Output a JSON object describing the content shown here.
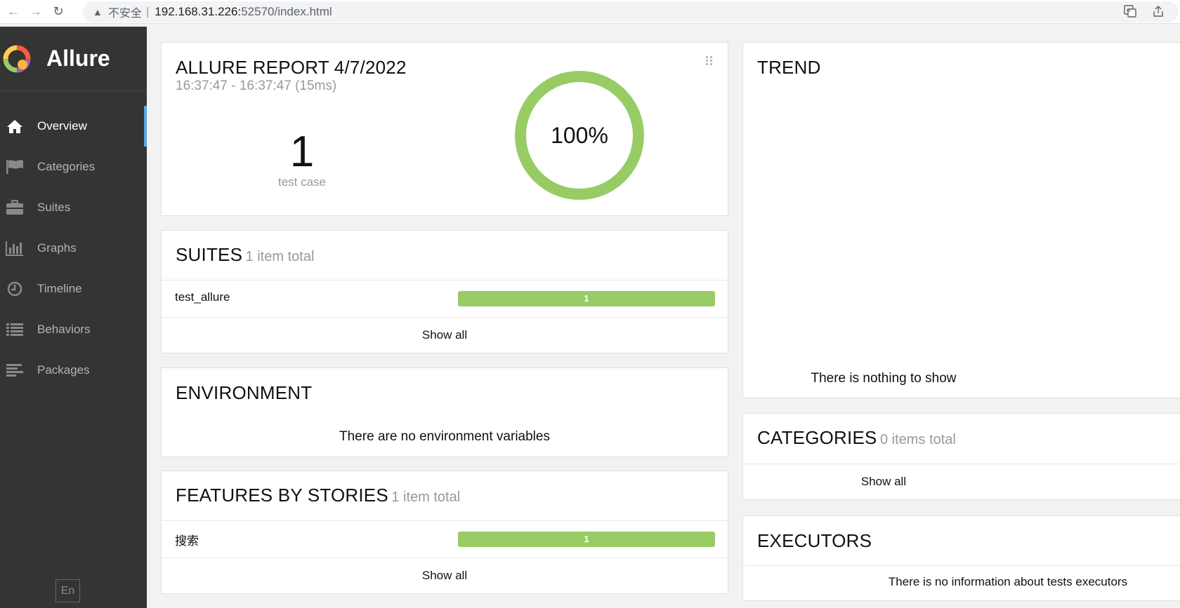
{
  "browser": {
    "back_icon": "←",
    "forward_icon": "→",
    "reload_icon": "↻",
    "security_warning": "不安全",
    "url_host": "192.168.31.226:",
    "url_rest": "52570/index.html"
  },
  "sidebar": {
    "brand": "Allure",
    "items": [
      {
        "label": "Overview",
        "icon": "home-icon",
        "active": true
      },
      {
        "label": "Categories",
        "icon": "flag-icon"
      },
      {
        "label": "Suites",
        "icon": "briefcase-icon"
      },
      {
        "label": "Graphs",
        "icon": "bar-chart-icon"
      },
      {
        "label": "Timeline",
        "icon": "clock-icon"
      },
      {
        "label": "Behaviors",
        "icon": "list-icon"
      },
      {
        "label": "Packages",
        "icon": "align-left-icon"
      }
    ],
    "language": "En"
  },
  "summary": {
    "title": "ALLURE REPORT 4/7/2022",
    "time_range": "16:37:47 - 16:37:47 (15ms)",
    "test_count": "1",
    "test_count_label": "test case",
    "percent": "100%",
    "pass_fraction": 1.0
  },
  "suites": {
    "title": "SUITES",
    "subtitle": "1 item total",
    "rows": [
      {
        "name": "test_allure",
        "count": "1"
      }
    ],
    "show_all": "Show all"
  },
  "environment": {
    "title": "ENVIRONMENT",
    "message": "There are no environment variables"
  },
  "features": {
    "title": "FEATURES BY STORIES",
    "subtitle": "1 item total",
    "rows": [
      {
        "name": "搜索",
        "count": "1"
      }
    ],
    "show_all": "Show all"
  },
  "trend": {
    "title": "TREND",
    "message": "There is nothing to show"
  },
  "categories": {
    "title": "CATEGORIES",
    "subtitle": "0 items total",
    "show_all": "Show all"
  },
  "executors": {
    "title": "EXECUTORS",
    "message": "There is no information about tests executors"
  },
  "colors": {
    "passed": "#97cc64",
    "sidebar_bg": "#343434",
    "active_marker": "#5aa5e6"
  }
}
